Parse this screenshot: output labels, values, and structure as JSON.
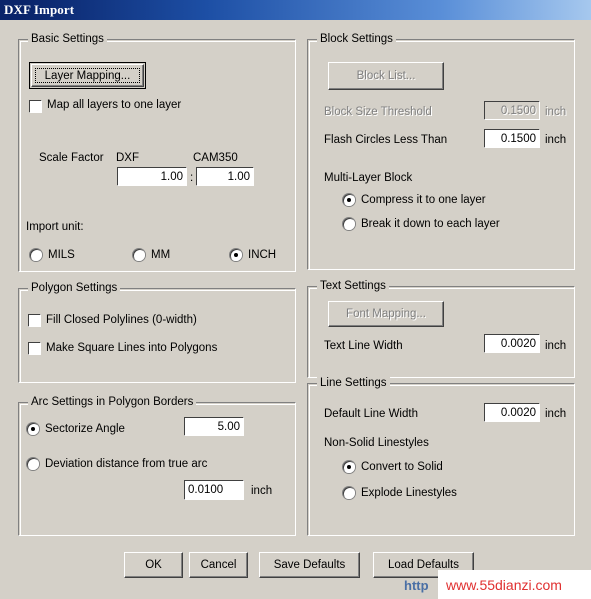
{
  "window": {
    "title": "DXF Import",
    "accent_title_start": "#0a246a",
    "accent_title_end": "#a6c8ee",
    "face": "#d4d0c8"
  },
  "basic_settings": {
    "title": "Basic Settings",
    "layer_mapping_button": "Layer Mapping...",
    "map_all_layers_label": "Map all layers to one layer",
    "map_all_layers_checked": false,
    "scale_factor_label": "Scale Factor",
    "dxf_label": "DXF",
    "cam350_label": "CAM350",
    "dxf_value": "1.00",
    "ratio_separator": ":",
    "cam350_value": "1.00",
    "import_unit_label": "Import unit:",
    "unit_options": [
      {
        "label": "MILS",
        "checked": false
      },
      {
        "label": "MM",
        "checked": false
      },
      {
        "label": "INCH",
        "checked": true
      }
    ]
  },
  "polygon_settings": {
    "title": "Polygon Settings",
    "options": [
      {
        "label": "Fill Closed Polylines (0-width)",
        "checked": false
      },
      {
        "label": "Make Square Lines into Polygons",
        "checked": false
      }
    ]
  },
  "arc_settings": {
    "title": "Arc Settings in Polygon Borders",
    "sectorize_label": "Sectorize Angle",
    "sectorize_checked": true,
    "sectorize_value": "5.00",
    "deviation_label": "Deviation distance from true arc",
    "deviation_checked": false,
    "deviation_value": "0.0100",
    "deviation_unit": "inch"
  },
  "block_settings": {
    "title": "Block Settings",
    "block_list_button": "Block List...",
    "block_list_enabled": false,
    "block_size_threshold_label": "Block Size Threshold",
    "block_size_threshold_value": "0.1500",
    "block_size_threshold_unit": "inch",
    "block_size_threshold_enabled": false,
    "flash_circles_label": "Flash Circles Less Than",
    "flash_circles_value": "0.1500",
    "flash_circles_unit": "inch",
    "multi_layer_label": "Multi-Layer Block",
    "multi_layer_options": [
      {
        "label": "Compress it to one layer",
        "checked": true
      },
      {
        "label": "Break it down to each layer",
        "checked": false
      }
    ]
  },
  "text_settings": {
    "title": "Text Settings",
    "font_mapping_button": "Font Mapping...",
    "font_mapping_enabled": false,
    "text_line_width_label": "Text Line Width",
    "text_line_width_value": "0.0020",
    "text_line_width_unit": "inch"
  },
  "line_settings": {
    "title": "Line Settings",
    "default_line_width_label": "Default Line Width",
    "default_line_width_value": "0.0020",
    "default_line_width_unit": "inch",
    "non_solid_label": "Non-Solid Linestyles",
    "non_solid_options": [
      {
        "label": "Convert to Solid",
        "checked": true
      },
      {
        "label": "Explode Linestyles",
        "checked": false
      }
    ]
  },
  "footer_buttons": [
    {
      "label": "OK"
    },
    {
      "label": "Cancel"
    },
    {
      "label": "Save Defaults"
    },
    {
      "label": "Load Defaults"
    }
  ],
  "watermark": {
    "http": "http",
    "url": "www.55dianzi.com"
  }
}
